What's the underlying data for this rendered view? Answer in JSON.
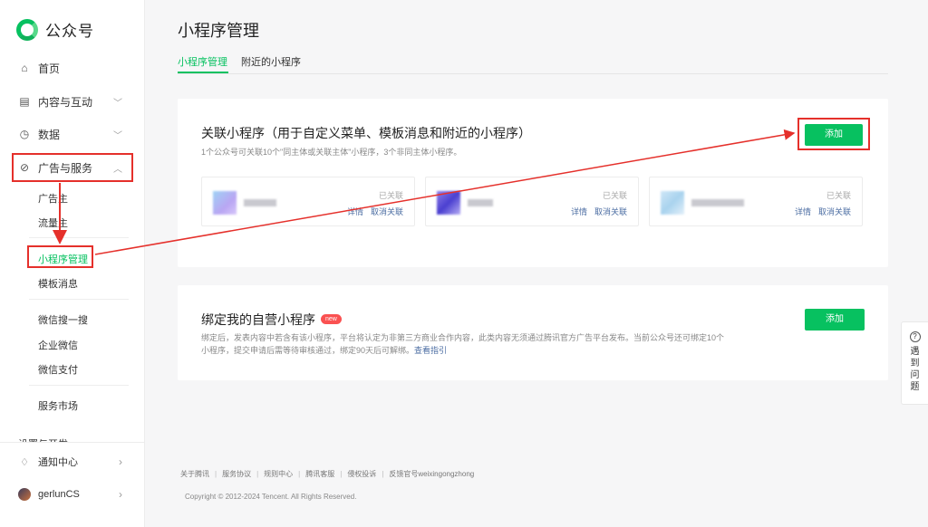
{
  "app": {
    "name": "公众号"
  },
  "sidebar": {
    "items": [
      {
        "label": "首页",
        "icon": "home-icon"
      },
      {
        "label": "内容与互动",
        "icon": "document-icon"
      },
      {
        "label": "数据",
        "icon": "clock-icon"
      },
      {
        "label": "广告与服务",
        "icon": "compass-icon"
      }
    ],
    "sub_items": [
      "广告主",
      "流量主",
      "小程序管理",
      "模板消息",
      "微信搜一搜",
      "企业微信",
      "微信支付",
      "服务市场"
    ],
    "cut_item": "设置与开发",
    "notifications": "通知中心",
    "user": "gerlunCS"
  },
  "main": {
    "title": "小程序管理",
    "tabs": [
      "小程序管理",
      "附近的小程序"
    ]
  },
  "card_linked": {
    "title": "关联小程序（用于自定义菜单、模板消息和附近的小程序）",
    "desc": "1个公众号可关联10个\"同主体或关联主体\"小程序，3个非同主体小程序。",
    "add_label": "添加",
    "programs": [
      {
        "status": "已关联",
        "detail": "详情",
        "unlink": "取消关联"
      },
      {
        "status": "已关联",
        "detail": "详情",
        "unlink": "取消关联"
      },
      {
        "status": "已关联",
        "detail": "详情",
        "unlink": "取消关联"
      }
    ]
  },
  "card_own": {
    "title": "绑定我的自营小程序",
    "badge": "new",
    "desc_line1": "绑定后，发表内容中若含有该小程序，平台将认定为非第三方商业合作内容，此类内容无须通过腾讯官方广告平台发布。当前公众号还可绑定10个",
    "desc_line2": "小程序，提交申请后需等待审核通过，绑定90天后可解绑。",
    "guide_link": "查看指引",
    "add_label": "添加"
  },
  "footer": {
    "links": [
      "关于腾讯",
      "服务协议",
      "规则中心",
      "腾讯客服",
      "侵权投诉",
      "反馈官号weixingongzhong"
    ],
    "copyright": "Copyright © 2012-2024 Tencent. All Rights Reserved."
  },
  "help": {
    "q": "?",
    "chars": [
      "遇",
      "到",
      "问",
      "题"
    ]
  },
  "colors": {
    "accent": "#07c160",
    "highlight": "#e5302b",
    "link": "#4c6ea3"
  }
}
